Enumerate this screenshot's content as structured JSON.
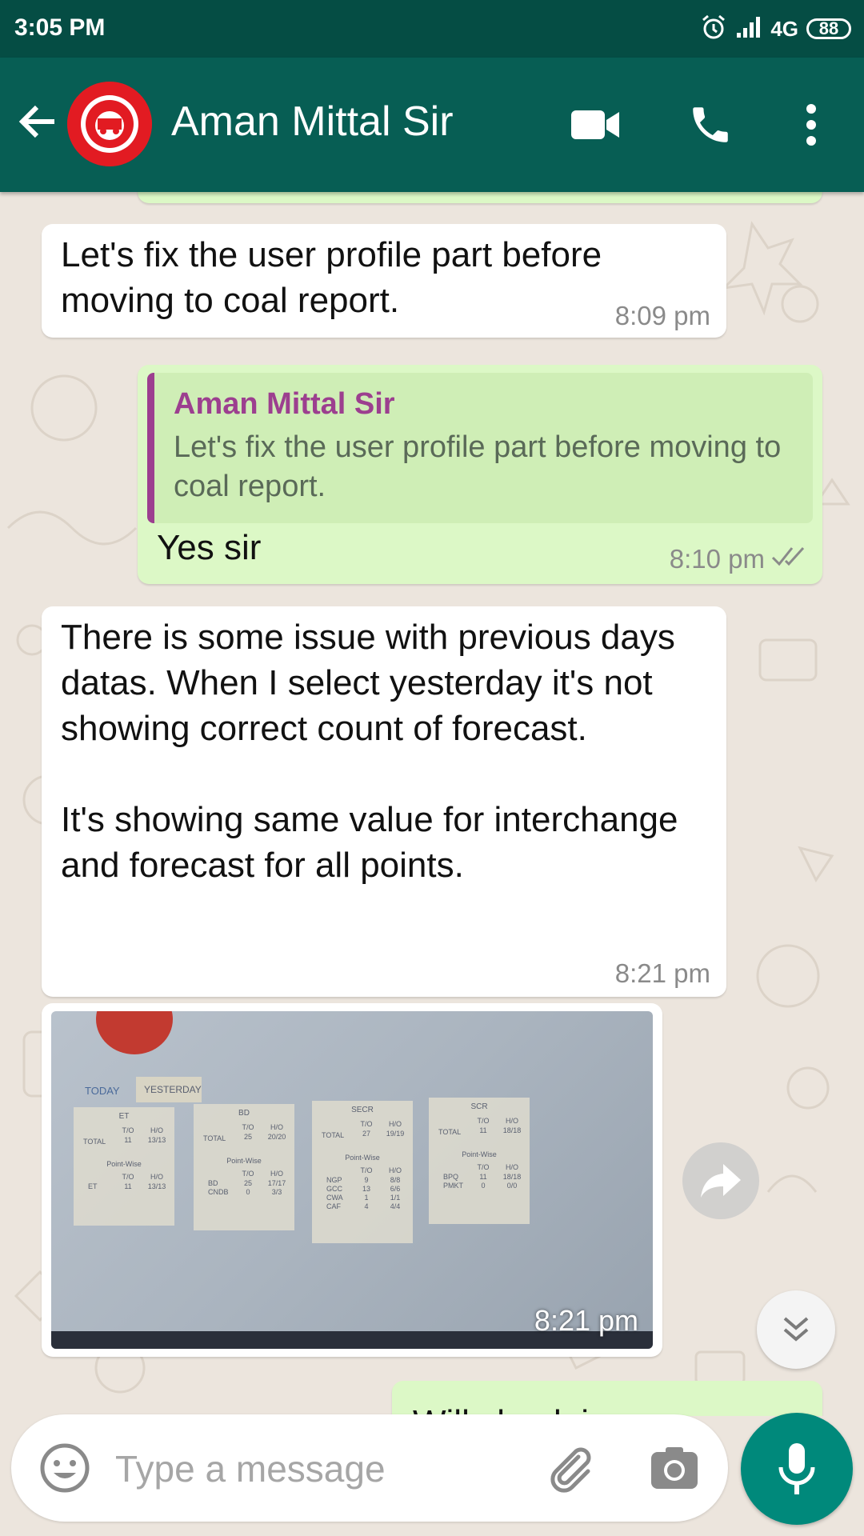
{
  "status_bar": {
    "time": "3:05 PM",
    "network": "4G",
    "battery": "88"
  },
  "header": {
    "contact_name": "Aman Mittal Sir"
  },
  "messages": [
    {
      "text": "Let's fix the user profile part before moving to coal report.",
      "time": "8:09 pm"
    },
    {
      "quote_name": "Aman Mittal Sir",
      "quote_text": "Let's fix the user profile part before moving to coal report.",
      "text": "Yes sir",
      "time": "8:10 pm"
    },
    {
      "text": "There is some issue with previous days datas. When I select yesterday it's not showing correct count of forecast.\n\nIt's showing same value for interchange and forecast for all points.",
      "time": "8:21 pm"
    },
    {
      "time": "8:21 pm",
      "photo": {
        "tabs": [
          "TODAY",
          "YESTERDAY"
        ],
        "col_headers": [
          "T/O",
          "H/O"
        ],
        "total_label": "TOTAL",
        "pointwise_label": "Point-Wise",
        "cards": [
          {
            "title": "ET",
            "total": [
              "11",
              "13/13"
            ],
            "rows": [
              [
                "ET",
                "11",
                "13/13"
              ]
            ]
          },
          {
            "title": "BD",
            "total": [
              "25",
              "20/20"
            ],
            "rows": [
              [
                "BD",
                "25",
                "17/17"
              ],
              [
                "CNDB",
                "0",
                "3/3"
              ]
            ]
          },
          {
            "title": "SECR",
            "total": [
              "27",
              "19/19"
            ],
            "rows": [
              [
                "NGP",
                "9",
                "8/8"
              ],
              [
                "GCC",
                "13",
                "6/6"
              ],
              [
                "CWA",
                "1",
                "1/1"
              ],
              [
                "CAF",
                "4",
                "4/4"
              ]
            ]
          },
          {
            "title": "SCR",
            "total": [
              "11",
              "18/18"
            ],
            "rows": [
              [
                "BPQ",
                "11",
                "18/18"
              ],
              [
                "PMKT",
                "0",
                "0/0"
              ]
            ]
          }
        ]
      }
    },
    {
      "text": "Will check i"
    }
  ],
  "input": {
    "placeholder": "Type a message"
  },
  "colors": {
    "header": "#075e54",
    "status_bar": "#054d44",
    "outgoing_bubble": "#dcf8c6",
    "incoming_bubble": "#ffffff",
    "accent": "#00897b",
    "quote_bar": "#9c3f8f",
    "read_ticks": "#8a8a8a"
  },
  "icons": [
    "back-arrow-icon",
    "video-call-icon",
    "phone-icon",
    "more-vert-icon",
    "alarm-icon",
    "signal-icon",
    "double-check-icon",
    "share-icon",
    "chevron-down-icon",
    "emoji-icon",
    "attachment-icon",
    "camera-icon",
    "mic-icon"
  ]
}
